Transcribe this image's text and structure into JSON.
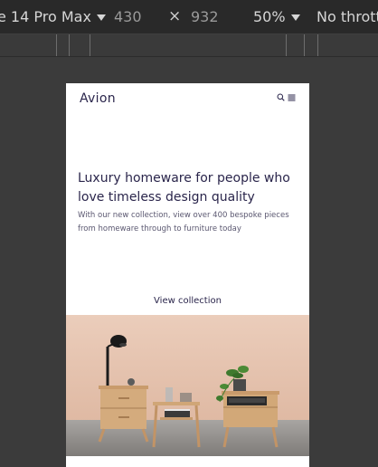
{
  "devtools": {
    "device_label": "e 14 Pro Max",
    "width_value": "430",
    "times_symbol": "×",
    "height_value": "932",
    "zoom_label": "50%",
    "throttle_label": "No thrott"
  },
  "page": {
    "logo": "Avion",
    "headline": "Luxury homeware for people who love timeless design quality",
    "subtext": "With our new collection, view over 400 bespoke pieces from homeware through to furniture today",
    "cta_label": "View collection"
  },
  "colors": {
    "brand_text": "#2a254b",
    "devtools_bg": "#292929",
    "wall": "#e8c8b5",
    "floor": "#9a9794",
    "wood": "#d2a878"
  }
}
